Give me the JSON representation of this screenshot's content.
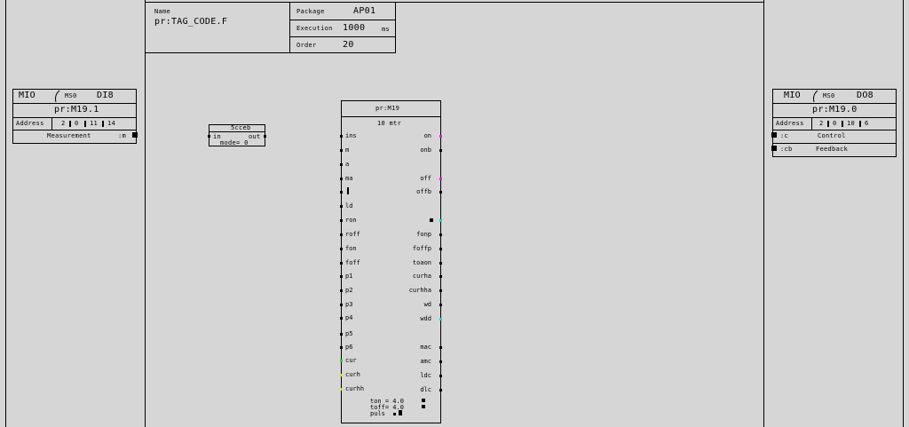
{
  "header": {
    "name_label": "Name",
    "name_value": "pr:TAG_CODE.F",
    "package_label": "Package",
    "package_value": "AP01",
    "execution_label": "Execution",
    "execution_value": "1000",
    "execution_unit": "ms",
    "order_label": "Order",
    "order_value": "20"
  },
  "left_io": {
    "type": "MIO",
    "ms": "MS0",
    "channel": "DI8",
    "tag": "pr:M19.1",
    "address_label": "Address",
    "address": [
      "2",
      "0",
      "11",
      "14"
    ],
    "signal_label": "Measurement",
    "signal_port": ":m"
  },
  "right_io": {
    "type": "MIO",
    "ms": "MS0",
    "channel": "DO8",
    "tag": "pr:M19.0",
    "address_label": "Address",
    "address": [
      "2",
      "0",
      "10",
      "6"
    ],
    "rows": [
      {
        "port": ":c",
        "label": "Control"
      },
      {
        "port": ":cb",
        "label": "Feedback"
      }
    ]
  },
  "small_block": {
    "type": "5cceb",
    "in": "in",
    "out": "out",
    "mode": "mode= 0"
  },
  "main_block": {
    "tag": "pr:M19",
    "type": "10 mtr",
    "inputs": [
      "ins",
      "m",
      "a",
      "ma",
      "",
      "ld",
      "ron",
      "roff",
      "fon",
      "foff",
      "p1",
      "p2",
      "p3",
      "p4",
      "p5",
      "p6",
      "cur",
      "curh",
      "curhh"
    ],
    "outputs": [
      "on",
      "onb",
      "off",
      "offb",
      "",
      "fonp",
      "foffp",
      "toaon",
      "curha",
      "curhha",
      "wd",
      "wdd",
      "mac",
      "amc",
      "ldc",
      "dlc"
    ],
    "params": [
      "ton = 4.0",
      "toff= 4.0",
      "puls"
    ],
    "colors": {
      "magenta": "#e020e0",
      "cyan": "#20d0e0",
      "green": "#30d030",
      "yellow": "#e0e020"
    }
  }
}
